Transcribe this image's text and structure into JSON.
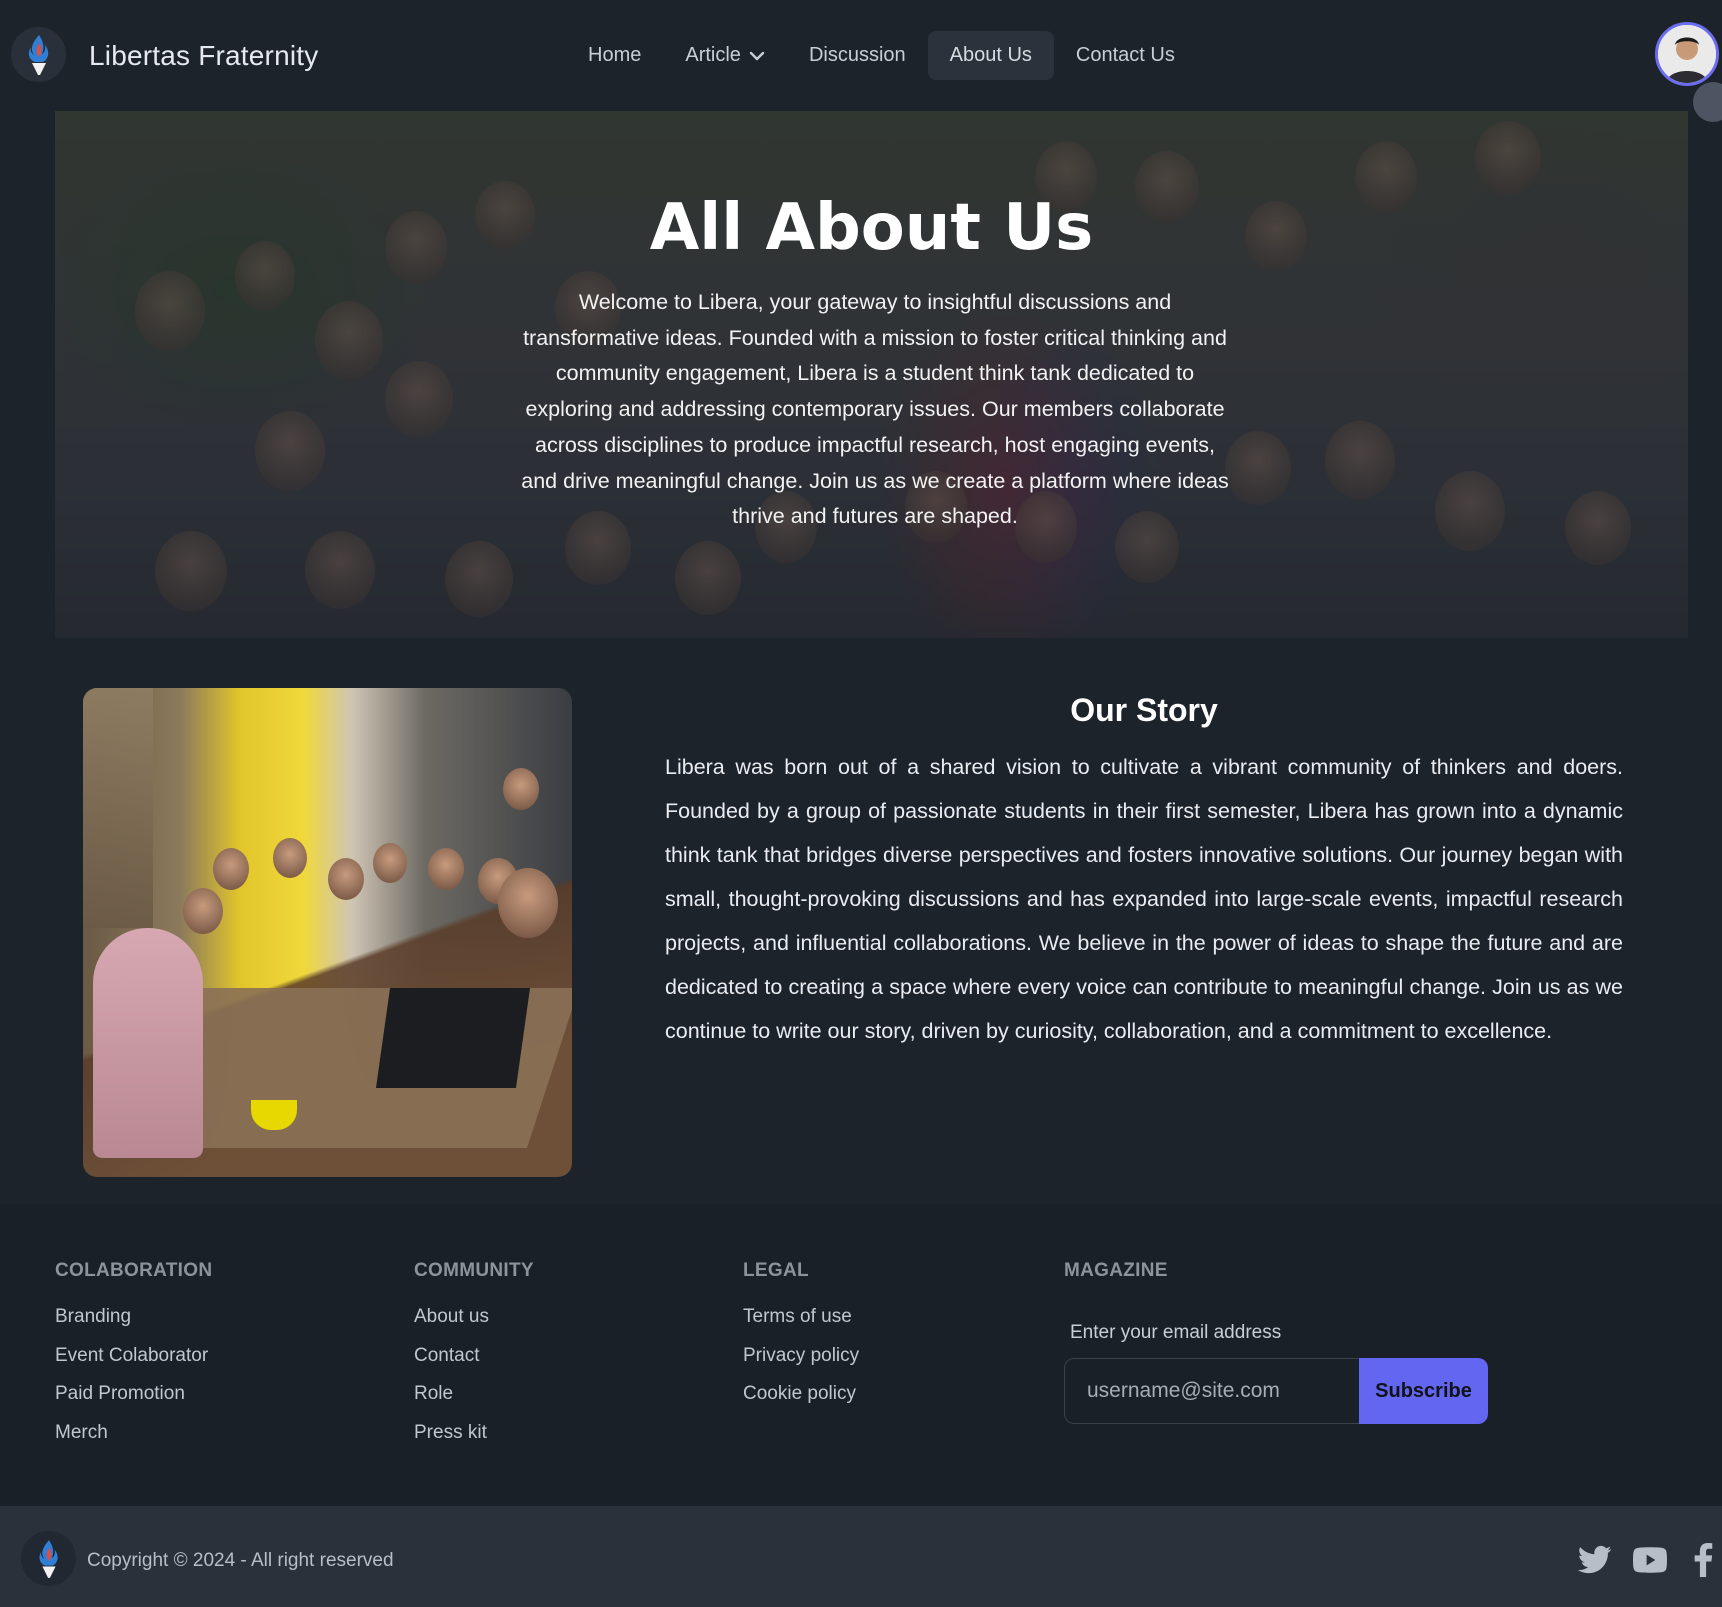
{
  "navbar": {
    "brand_name": "Libertas Fraternity",
    "items": [
      {
        "label": "Home"
      },
      {
        "label": "Article",
        "icon": "chevron-down-icon"
      },
      {
        "label": "Discussion"
      },
      {
        "label": "About Us",
        "active": true
      },
      {
        "label": "Contact Us"
      }
    ]
  },
  "hero": {
    "title": "All About Us",
    "text": "Welcome to Libera, your gateway to insightful discussions and transformative ideas. Founded with a mission to foster critical thinking and community engagement, Libera is a student think tank dedicated to exploring and addressing contemporary issues. Our members collaborate across disciplines to produce impactful research, host engaging events, and drive meaningful change. Join us as we create a platform where ideas thrive and futures are shaped."
  },
  "story": {
    "title": "Our Story",
    "text": "Libera was born out of a shared vision to cultivate a vibrant community of thinkers and doers. Founded by a group of passionate students in their first semester, Libera has grown into a dynamic think tank that bridges diverse perspectives and fosters innovative solutions. Our journey began with small, thought-provoking discussions and has expanded into large-scale events, impactful research projects, and influential collaborations. We believe in the power of ideas to shape the future and are dedicated to creating a space where every voice can contribute to meaningful change. Join us as we continue to write our story, driven by curiosity, collaboration, and a commitment to excellence."
  },
  "footer": {
    "columns": [
      {
        "heading": "COLABORATION",
        "links": [
          "Branding",
          "Event Colaborator",
          "Paid Promotion",
          "Merch"
        ]
      },
      {
        "heading": "COMMUNITY",
        "links": [
          "About us",
          "Contact",
          "Role",
          "Press kit"
        ]
      },
      {
        "heading": "LEGAL",
        "links": [
          "Terms of use",
          "Privacy policy",
          "Cookie policy"
        ]
      }
    ],
    "magazine": {
      "heading": "MAGAZINE",
      "label": "Enter your email address",
      "placeholder": "username@site.com",
      "button": "Subscribe"
    },
    "copyright": "Copyright © 2024 - All right reserved",
    "social": [
      "twitter-icon",
      "youtube-icon",
      "facebook-icon"
    ]
  },
  "colors": {
    "background": "#1d232a",
    "accent": "#6366f1",
    "footer": "#1a2027",
    "bottom_bar": "#2a313b"
  }
}
